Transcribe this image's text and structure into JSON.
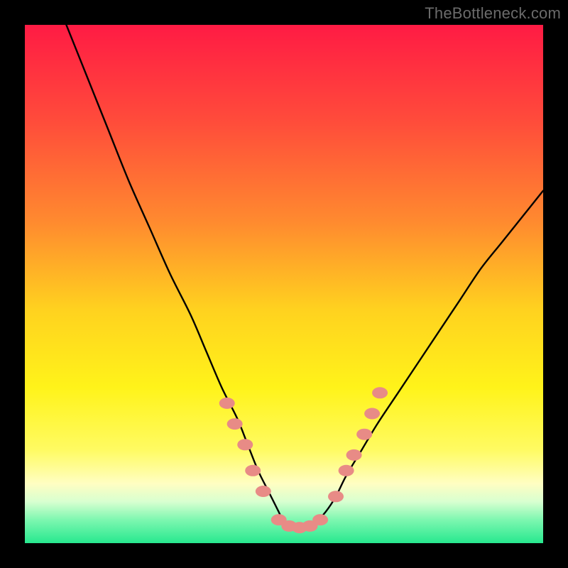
{
  "watermark": "TheBottleneck.com",
  "colors": {
    "frame": "#000000",
    "curve": "#000000",
    "marker_fill": "#e88b86",
    "marker_stroke": "#e88b86",
    "gradient_stops": [
      {
        "offset": 0.0,
        "color": "#ff1b44"
      },
      {
        "offset": 0.18,
        "color": "#ff4a3b"
      },
      {
        "offset": 0.38,
        "color": "#ff8a2f"
      },
      {
        "offset": 0.55,
        "color": "#ffd21f"
      },
      {
        "offset": 0.7,
        "color": "#fff31a"
      },
      {
        "offset": 0.82,
        "color": "#fffb62"
      },
      {
        "offset": 0.885,
        "color": "#fffec2"
      },
      {
        "offset": 0.92,
        "color": "#d8ffd0"
      },
      {
        "offset": 0.955,
        "color": "#7df7b0"
      },
      {
        "offset": 1.0,
        "color": "#27e88f"
      }
    ]
  },
  "chart_data": {
    "type": "line",
    "title": "",
    "xlabel": "",
    "ylabel": "",
    "xlim": [
      0,
      100
    ],
    "ylim": [
      0,
      100
    ],
    "grid": false,
    "series": [
      {
        "name": "bottleneck-curve",
        "x": [
          8,
          12,
          16,
          20,
          24,
          28,
          32,
          35,
          38,
          41,
          43,
          45,
          47,
          49,
          50,
          52,
          54,
          56,
          58,
          60,
          62,
          65,
          68,
          72,
          76,
          80,
          84,
          88,
          92,
          96,
          100
        ],
        "values": [
          100,
          90,
          80,
          70,
          61,
          52,
          44,
          37,
          30,
          24,
          19,
          14,
          10,
          6,
          4,
          3,
          3,
          4,
          6,
          9,
          13,
          18,
          23,
          29,
          35,
          41,
          47,
          53,
          58,
          63,
          68
        ]
      }
    ],
    "markers": {
      "name": "highlighted-points",
      "points": [
        {
          "x": 39.0,
          "y": 27
        },
        {
          "x": 40.5,
          "y": 23
        },
        {
          "x": 42.5,
          "y": 19
        },
        {
          "x": 44.0,
          "y": 14
        },
        {
          "x": 46.0,
          "y": 10
        },
        {
          "x": 49.0,
          "y": 4.5
        },
        {
          "x": 51.0,
          "y": 3.3
        },
        {
          "x": 53.0,
          "y": 3.0
        },
        {
          "x": 55.0,
          "y": 3.3
        },
        {
          "x": 57.0,
          "y": 4.5
        },
        {
          "x": 60.0,
          "y": 9
        },
        {
          "x": 62.0,
          "y": 14
        },
        {
          "x": 63.5,
          "y": 17
        },
        {
          "x": 65.5,
          "y": 21
        },
        {
          "x": 67.0,
          "y": 25
        },
        {
          "x": 68.5,
          "y": 29
        }
      ]
    }
  }
}
